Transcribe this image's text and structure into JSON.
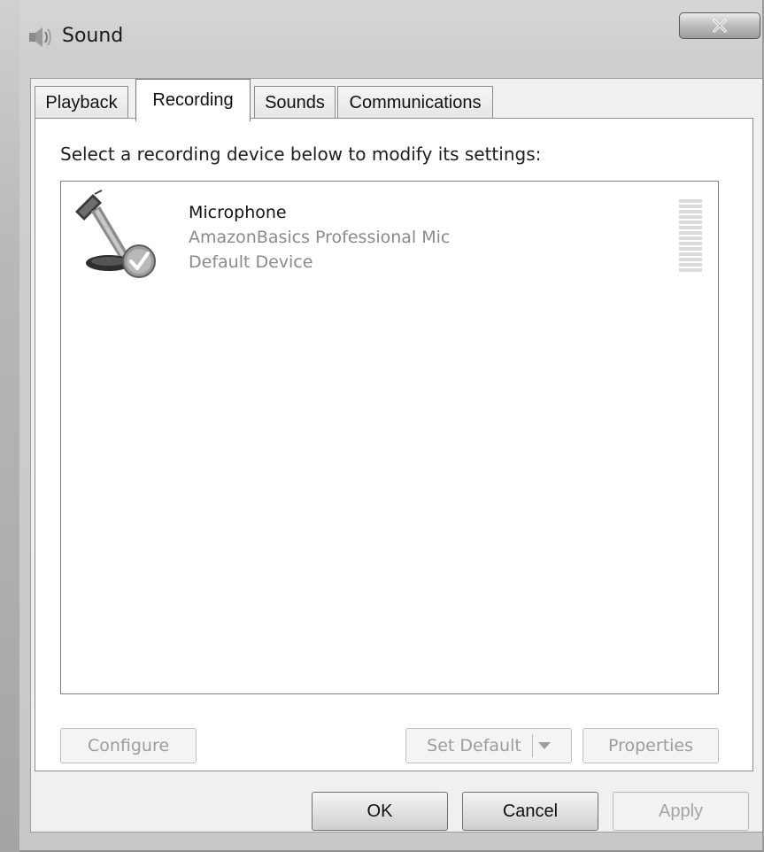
{
  "window": {
    "title": "Sound",
    "title_icon": "speaker-icon",
    "close_icon": "close-icon"
  },
  "tabs": [
    {
      "label": "Playback",
      "active": false
    },
    {
      "label": "Recording",
      "active": true
    },
    {
      "label": "Sounds",
      "active": false
    },
    {
      "label": "Communications",
      "active": false
    }
  ],
  "recording": {
    "instructions": "Select a recording device below to modify its settings:",
    "devices": [
      {
        "name": "Microphone",
        "description": "AmazonBasics Professional Mic",
        "status": "Default Device",
        "icon": "microphone-icon",
        "badge_icon": "default-check-icon",
        "level": 0
      }
    ],
    "buttons": {
      "configure": "Configure",
      "set_default": "Set Default",
      "properties": "Properties"
    }
  },
  "dialog_buttons": {
    "ok": "OK",
    "cancel": "Cancel",
    "apply": "Apply"
  }
}
